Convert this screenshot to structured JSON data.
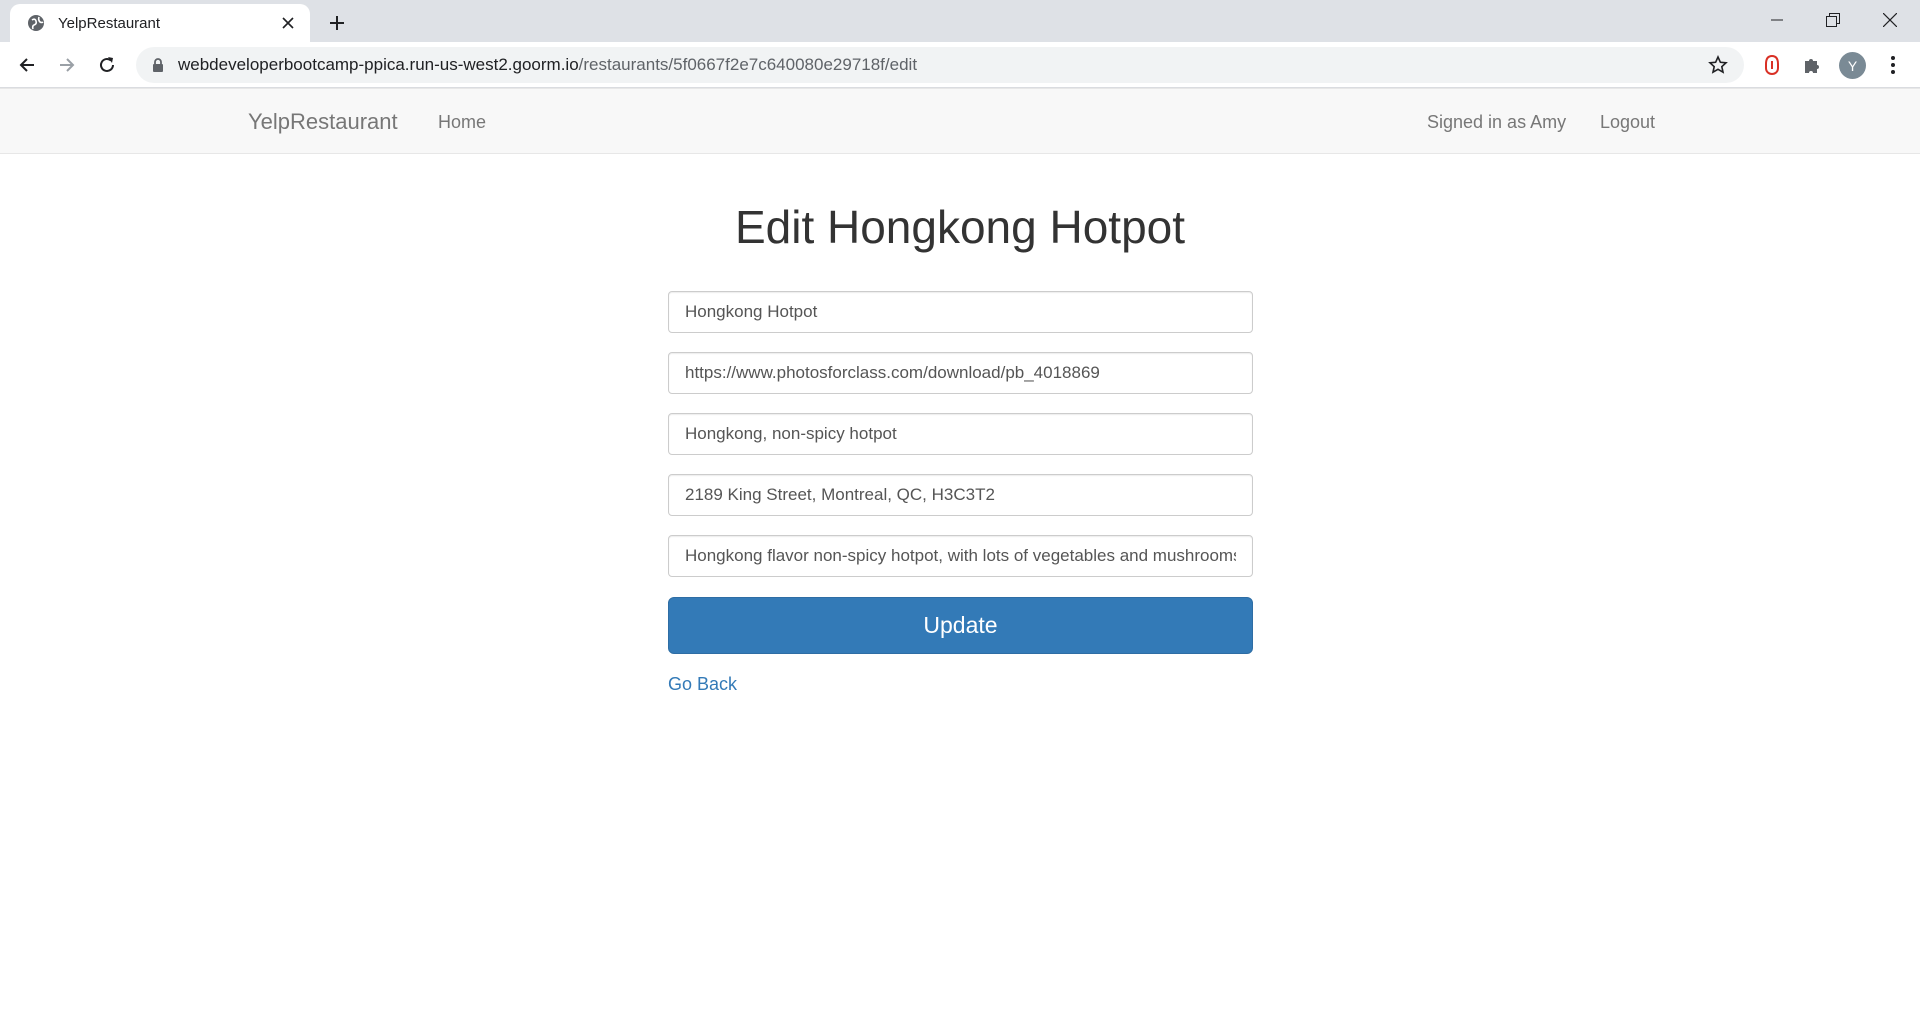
{
  "browser": {
    "tab_title": "YelpRestaurant",
    "url_host": "webdeveloperbootcamp-ppica.run-us-west2.goorm.io",
    "url_path": "/restaurants/5f0667f2e7c640080e29718f/edit",
    "profile_initial": "Y",
    "icons": [
      "globe-icon",
      "close-icon",
      "plus-icon",
      "minimize-icon",
      "restore-icon",
      "window-close-icon",
      "back-icon",
      "forward-icon",
      "reload-icon",
      "lock-icon",
      "star-icon",
      "extension-icon",
      "puzzle-icon",
      "menu-icon"
    ]
  },
  "navbar": {
    "brand": "YelpRestaurant",
    "home": "Home",
    "signed_in": "Signed in as Amy",
    "logout": "Logout"
  },
  "main": {
    "title": "Edit Hongkong Hotpot",
    "fields": {
      "name": "Hongkong Hotpot",
      "image": "https://www.photosforclass.com/download/pb_4018869",
      "cuisine": "Hongkong, non-spicy hotpot",
      "address": "2189 King Street, Montreal, QC, H3C3T2",
      "description": "Hongkong flavor non-spicy hotpot, with lots of vegetables and mushrooms"
    },
    "update_label": "Update",
    "go_back_label": "Go Back"
  },
  "colors": {
    "primary": "#337ab7",
    "navbar_bg": "#f8f8f8",
    "extension_red": "#d93025"
  }
}
